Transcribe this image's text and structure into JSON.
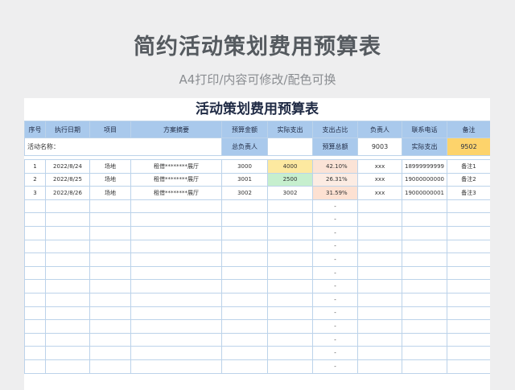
{
  "header": {
    "title": "简约活动策划费用预算表",
    "subtitle": "A4打印/内容可修改/配色可换"
  },
  "sheet": {
    "title": "活动策划费用预算表",
    "info": {
      "activity_label": "活动名称：",
      "owner_label": "总负责人",
      "owner_value": "",
      "budget_total_label": "预算总额",
      "budget_total_value": "9003",
      "actual_total_label": "实际支出",
      "actual_total_value": "9502"
    },
    "columns": [
      "序号",
      "执行日期",
      "项目",
      "方案摘要",
      "预算金额",
      "实际支出",
      "支出占比",
      "负责人",
      "联系电话",
      "备注"
    ],
    "rows": [
      [
        "1",
        "2022/8/24",
        "场地",
        "租借********展厅",
        "3000",
        "4000",
        "42.10%",
        "xxx",
        "18999999999",
        "备注1"
      ],
      [
        "2",
        "2022/8/25",
        "场地",
        "租借********展厅",
        "3001",
        "2500",
        "26.31%",
        "xxx",
        "19000000000",
        "备注2"
      ],
      [
        "3",
        "2022/8/26",
        "场地",
        "租借********展厅",
        "3002",
        "3002",
        "31.59%",
        "xxx",
        "19000000001",
        "备注3"
      ]
    ],
    "empty_placeholder": "-",
    "empty_row_count": 13
  },
  "colors": {
    "header_blue": "#a9c9ec",
    "total_yellow": "#fdd36b",
    "over_budget_yellow": "#fde9a0",
    "under_budget_green": "#c6efce",
    "percent_peach": "#fbe3d6"
  }
}
